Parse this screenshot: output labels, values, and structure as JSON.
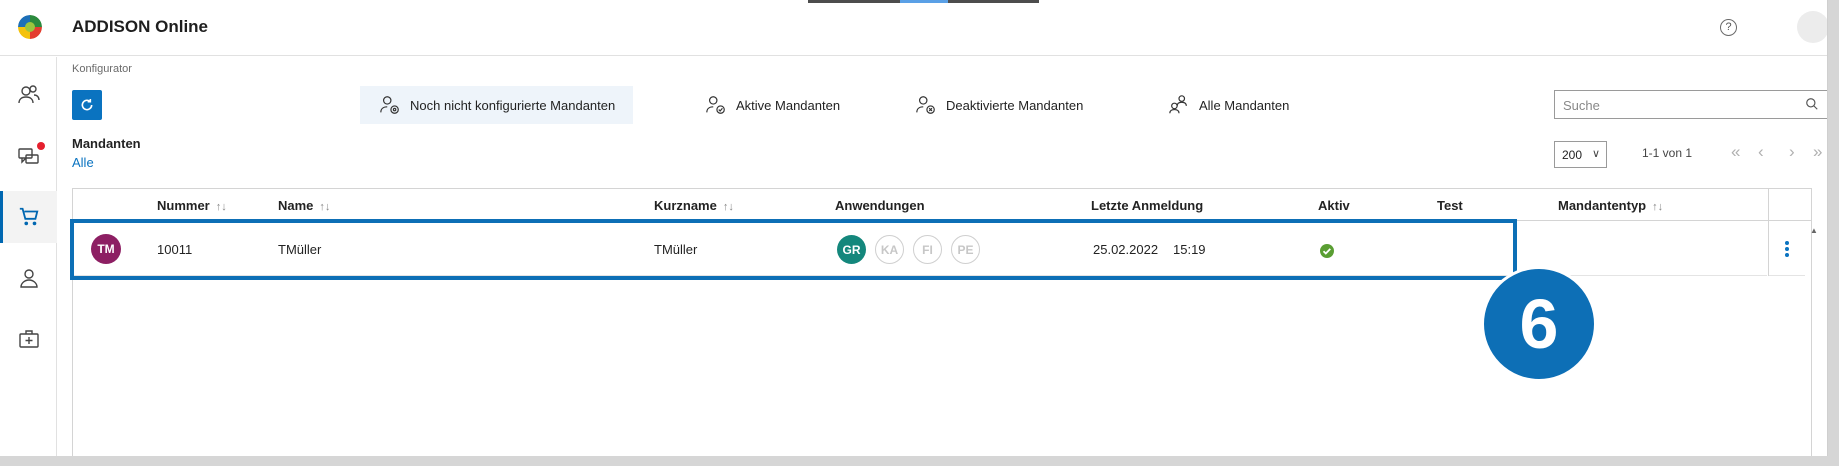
{
  "header": {
    "app_title": "ADDISON Online",
    "help_symbol": "?"
  },
  "sidebar": {
    "items": [
      {
        "icon": "users-icon",
        "active": false
      },
      {
        "icon": "chat-notification-icon",
        "active": false,
        "notification_color": "#e5202e"
      },
      {
        "icon": "cart-icon",
        "active": true
      },
      {
        "icon": "person-icon",
        "active": false
      },
      {
        "icon": "medical-kit-icon",
        "active": false
      }
    ]
  },
  "breadcrumb": "Konfigurator",
  "filters": {
    "tabs": [
      {
        "label": "Noch nicht konfigurierte Mandanten",
        "icon": "user-settings-icon",
        "selected": true
      },
      {
        "label": "Aktive Mandanten",
        "icon": "user-check-icon",
        "selected": false
      },
      {
        "label": "Deaktivierte Mandanten",
        "icon": "user-x-icon",
        "selected": false
      },
      {
        "label": "Alle Mandanten",
        "icon": "users-group-icon",
        "selected": false
      }
    ]
  },
  "search": {
    "placeholder": "Suche"
  },
  "mandanten": {
    "label": "Mandanten",
    "value": "Alle"
  },
  "pagination": {
    "page_size": "200",
    "info": "1-1 von 1"
  },
  "table": {
    "columns": [
      {
        "label": "Nummer",
        "sortable": true
      },
      {
        "label": "Name",
        "sortable": true
      },
      {
        "label": "Kurzname",
        "sortable": true
      },
      {
        "label": "Anwendungen",
        "sortable": false
      },
      {
        "label": "Letzte Anmeldung",
        "sortable": false
      },
      {
        "label": "Aktiv",
        "sortable": false
      },
      {
        "label": "Test",
        "sortable": false
      },
      {
        "label": "Mandantentyp",
        "sortable": true
      }
    ],
    "sort_symbol": "↑↓",
    "rows": [
      {
        "initials": "TM",
        "nummer": "10011",
        "name": "TMüller",
        "kurzname": "TMüller",
        "apps": [
          {
            "code": "GR",
            "enabled": true
          },
          {
            "code": "KA",
            "enabled": false
          },
          {
            "code": "FI",
            "enabled": false
          },
          {
            "code": "PE",
            "enabled": false
          }
        ],
        "date": "25.02.2022",
        "time": "15:19",
        "aktiv": true
      }
    ]
  },
  "callout": {
    "number": "6"
  },
  "colors": {
    "primary": "#0a73c0",
    "highlight": "#0d6fb6",
    "app_enabled": "#14877c",
    "avatar": "#8d1f63",
    "status_ok": "#5a9e33"
  }
}
